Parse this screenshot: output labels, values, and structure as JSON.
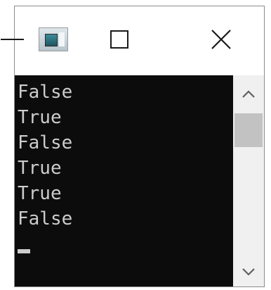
{
  "window": {
    "icons": {
      "minimize": "minimize-icon",
      "app": "console-app-icon",
      "maximize": "maximize-icon",
      "close": "close-icon"
    }
  },
  "console": {
    "lines": [
      "False",
      "True",
      "False",
      "True",
      "True",
      "False"
    ],
    "background": "#0c0c0c",
    "foreground": "#cccccc"
  },
  "scrollbar": {
    "up_icon": "chevron-up-icon",
    "down_icon": "chevron-down-icon"
  }
}
